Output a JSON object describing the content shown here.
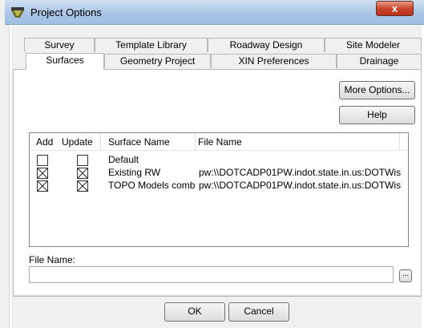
{
  "window": {
    "title": "Project Options",
    "close_glyph": "x"
  },
  "tabs_row1": [
    {
      "label": "Survey"
    },
    {
      "label": "Template Library"
    },
    {
      "label": "Roadway Design"
    },
    {
      "label": "Site Modeler"
    }
  ],
  "tabs_row2": [
    {
      "label": "Surfaces",
      "active": true
    },
    {
      "label": "Geometry Project"
    },
    {
      "label": "XIN Preferences"
    },
    {
      "label": "Drainage"
    }
  ],
  "buttons": {
    "more_options": "More Options...",
    "help": "Help",
    "ok": "OK",
    "cancel": "Cancel",
    "browse": "..."
  },
  "table": {
    "headers": [
      "Add",
      "Update",
      "Surface Name",
      "File Name"
    ],
    "rows": [
      {
        "add": false,
        "update": false,
        "surface": "Default",
        "file": ""
      },
      {
        "add": true,
        "update": true,
        "surface": "Existing RW",
        "file": "pw:\\\\DOTCADP01PW.indot.state.in.us:DOTWis"
      },
      {
        "add": true,
        "update": true,
        "surface": "TOPO Models comb",
        "file": "pw:\\\\DOTCADP01PW.indot.state.in.us:DOTWis"
      }
    ]
  },
  "file_name": {
    "label": "File Name:",
    "value": ""
  },
  "icons": {
    "app": "project-options-app-icon",
    "close": "close-icon",
    "checked": "cross-check-icon"
  }
}
